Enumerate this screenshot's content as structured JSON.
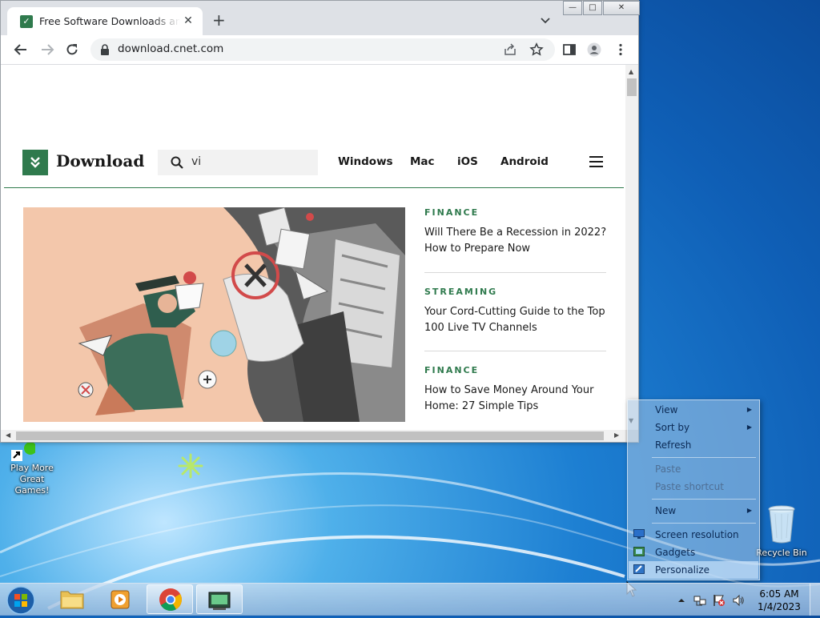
{
  "browser": {
    "tab_title": "Free Software Downloads and Re",
    "url": "download.cnet.com"
  },
  "site": {
    "logo_text": "Download",
    "search_value": "vi",
    "nav": [
      "Windows",
      "Mac",
      "iOS",
      "Android"
    ],
    "articles": [
      {
        "category": "FINANCE",
        "line1": "Will There Be a Recession in 2022?",
        "line2": "How to Prepare Now"
      },
      {
        "category": "STREAMING",
        "line1": "Your Cord-Cutting Guide to the Top",
        "line2": "100 Live TV Channels"
      },
      {
        "category": "FINANCE",
        "line1": "How to Save Money Around Your",
        "line2": "Home: 27 Simple Tips"
      }
    ]
  },
  "desktop": {
    "icons": {
      "play_games_line1": "Play More",
      "play_games_line2": "Great Games!",
      "recycle_bin": "Recycle Bin"
    }
  },
  "context_menu": {
    "view": "View",
    "sort_by": "Sort by",
    "refresh": "Refresh",
    "paste": "Paste",
    "paste_shortcut": "Paste shortcut",
    "new": "New",
    "screen_resolution": "Screen resolution",
    "gadgets": "Gadgets",
    "personalize": "Personalize"
  },
  "taskbar": {
    "time": "6:05 AM",
    "date": "1/4/2023"
  },
  "colors": {
    "brand_green": "#2f7a4d",
    "desktop_blue": "#1d7fd2"
  }
}
